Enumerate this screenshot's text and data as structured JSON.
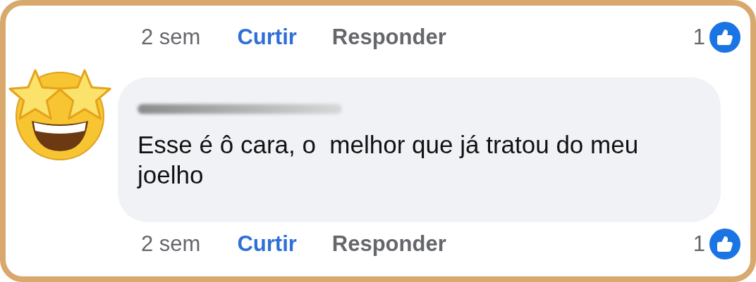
{
  "top_actions": {
    "time": "2 sem",
    "like_link": "Curtir",
    "reply_link": "Responder",
    "reaction_count": "1"
  },
  "comment": {
    "text": "Esse é ô cara, o  melhor que já tratou do meu joelho",
    "actions": {
      "time": "2 sem",
      "like_link": "Curtir",
      "reply_link": "Responder",
      "reaction_count": "1"
    }
  }
}
